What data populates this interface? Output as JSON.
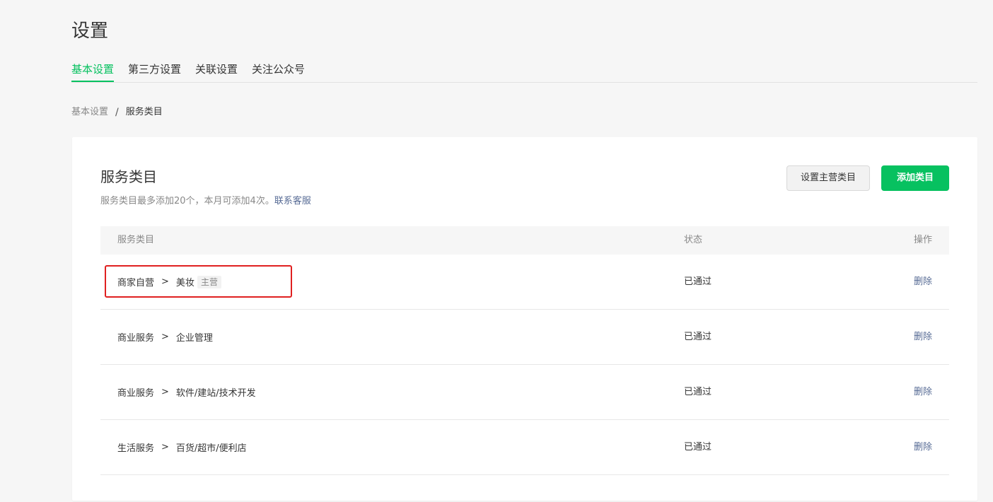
{
  "page": {
    "title": "设置"
  },
  "tabs": [
    {
      "label": "基本设置",
      "active": true
    },
    {
      "label": "第三方设置",
      "active": false
    },
    {
      "label": "关联设置",
      "active": false
    },
    {
      "label": "关注公众号",
      "active": false
    }
  ],
  "breadcrumb": {
    "parent": "基本设置",
    "separator": "/",
    "current": "服务类目"
  },
  "section": {
    "title": "服务类目",
    "description": "服务类目最多添加20个，本月可添加4次。",
    "contact_link": "联系客服",
    "set_main_button": "设置主营类目",
    "add_button": "添加类目"
  },
  "table": {
    "headers": {
      "name": "服务类目",
      "status": "状态",
      "action": "操作"
    },
    "rows": [
      {
        "parent": "商家自营",
        "separator": ">",
        "child": "美妆",
        "tag": "主营",
        "status": "已通过",
        "action": "删除"
      },
      {
        "parent": "商业服务",
        "separator": ">",
        "child": "企业管理",
        "tag": "",
        "status": "已通过",
        "action": "删除"
      },
      {
        "parent": "商业服务",
        "separator": ">",
        "child": "软件/建站/技术开发",
        "tag": "",
        "status": "已通过",
        "action": "删除"
      },
      {
        "parent": "生活服务",
        "separator": ">",
        "child": "百货/超市/便利店",
        "tag": "",
        "status": "已通过",
        "action": "删除"
      }
    ]
  },
  "colors": {
    "accent": "#07c160",
    "link": "#576b95",
    "highlight": "#e02020"
  }
}
